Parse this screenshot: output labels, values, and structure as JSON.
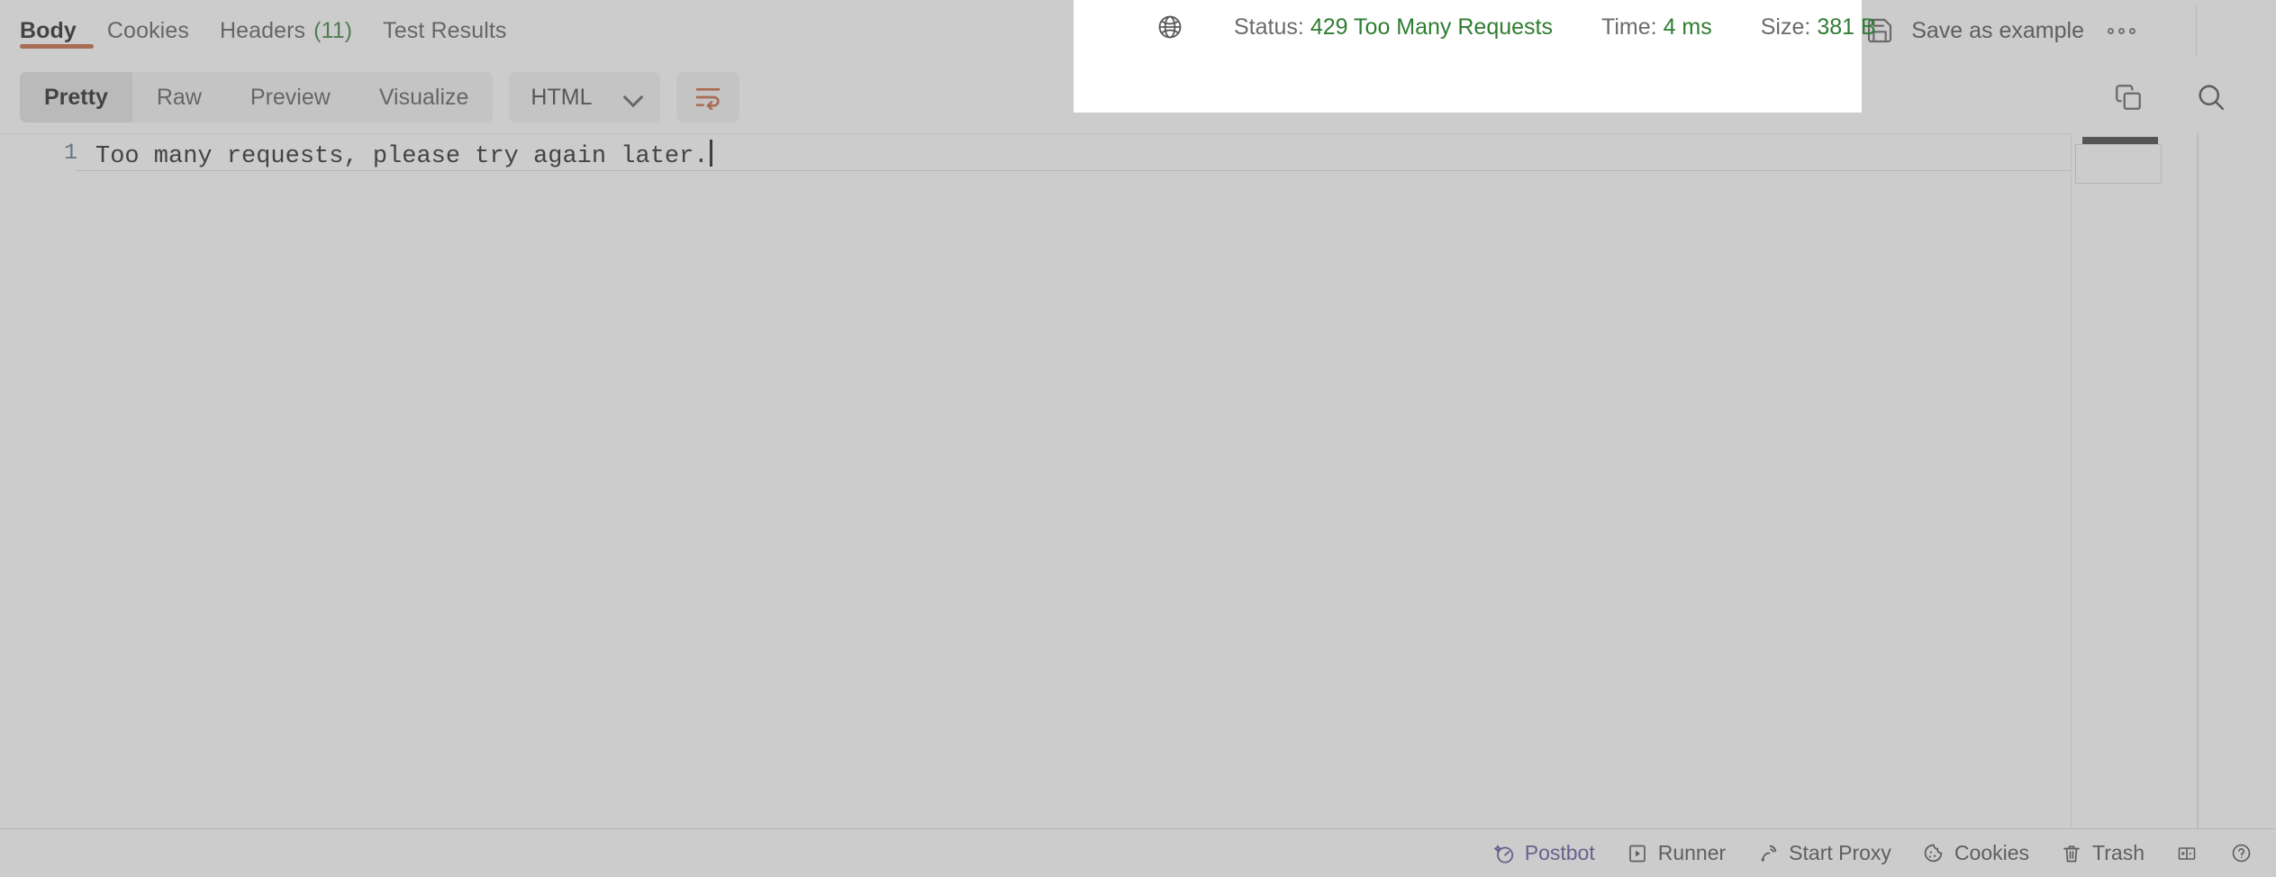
{
  "response_tabs": [
    {
      "label": "Body",
      "count": null,
      "active": true,
      "name": "tab-body"
    },
    {
      "label": "Cookies",
      "count": null,
      "active": false,
      "name": "tab-cookies"
    },
    {
      "label": "Headers",
      "count": "(11)",
      "active": false,
      "name": "tab-headers"
    },
    {
      "label": "Test Results",
      "count": null,
      "active": false,
      "name": "tab-test-results"
    }
  ],
  "view_modes": [
    {
      "label": "Pretty",
      "active": true
    },
    {
      "label": "Raw",
      "active": false
    },
    {
      "label": "Preview",
      "active": false
    },
    {
      "label": "Visualize",
      "active": false
    }
  ],
  "format_select": {
    "value": "HTML",
    "chevron_icon": "chevron-down-icon"
  },
  "wrap_toggle": {
    "icon": "word-wrap-icon",
    "active": true,
    "color": "#c4613a"
  },
  "toolbar_right_icons": [
    {
      "name": "copy-icon",
      "label": "Copy to clipboard"
    },
    {
      "name": "search-icon",
      "label": "Search"
    }
  ],
  "editor": {
    "line_number": "1",
    "body_text": "Too many requests, please try again later.",
    "language": "HTML",
    "caret_visible": true
  },
  "response_meta": {
    "globe_icon": "globe-icon",
    "status_label": "Status:",
    "status_value": "429 Too Many Requests",
    "time_label": "Time:",
    "time_value": "4 ms",
    "size_label": "Size:",
    "size_value": "381 B",
    "value_color": "#2f7d32",
    "label_color": "#6b6b6b"
  },
  "save_example": {
    "icon": "save-icon",
    "label": "Save as example",
    "kebab_icon": "more-options-icon"
  },
  "statusbar_items": [
    {
      "label": "Postbot",
      "icon": "postbot-icon",
      "accent": "#5b4b93"
    },
    {
      "label": "Runner",
      "icon": "runner-icon",
      "accent": "#4a4a4a"
    },
    {
      "label": "Start Proxy",
      "icon": "proxy-icon",
      "accent": "#4a4a4a"
    },
    {
      "label": "Cookies",
      "icon": "cookie-icon",
      "accent": "#4a4a4a"
    },
    {
      "label": "Trash",
      "icon": "trash-icon",
      "accent": "#4a4a4a"
    }
  ],
  "statusbar_icon_only": [
    {
      "name": "layout-toggle-icon"
    },
    {
      "name": "help-icon"
    }
  ]
}
